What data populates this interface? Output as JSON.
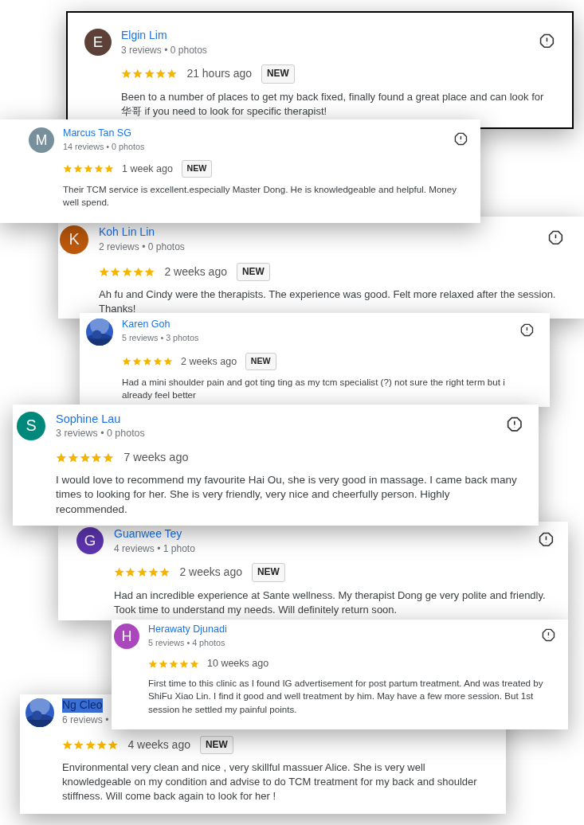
{
  "reviews": [
    {
      "name": "Elgin Lim",
      "name_highlighted": false,
      "meta": "3 reviews • 0 photos",
      "avatar": {
        "kind": "letter",
        "letter": "E",
        "color": "#5d4037"
      },
      "stars": 5,
      "time": "21 hours ago",
      "badge": "NEW",
      "text": "Been to a number of places to get my back fixed, finally found a great place and can look for 华哥 if you need to look for specific therapist!"
    },
    {
      "name": "Marcus Tan SG",
      "name_highlighted": false,
      "meta": "14 reviews • 0 photos",
      "avatar": {
        "kind": "letter",
        "letter": "M",
        "color": "#78909c"
      },
      "stars": 5,
      "time": "1 week ago",
      "badge": "NEW",
      "text": "Their TCM service is excellent.especially Master Dong. He is knowledgeable and helpful. Money well spend."
    },
    {
      "name": "Koh Lin Lin",
      "name_highlighted": false,
      "meta": "2 reviews • 0 photos",
      "avatar": {
        "kind": "letter",
        "letter": "K",
        "color": "#bf5a0b"
      },
      "stars": 5,
      "time": "2 weeks ago",
      "badge": "NEW",
      "text": "Ah fu and Cindy were the therapists. The experience was good. Felt more relaxed after the session. Thanks!"
    },
    {
      "name": "Karen Goh",
      "name_highlighted": false,
      "meta": "5 reviews • 3 photos",
      "stars": 5,
      "time": "2 weeks ago",
      "badge": "NEW",
      "text": "Had a mini shoulder pain and got ting ting as my tcm specialist (?) not sure the right term but i already feel better"
    },
    {
      "name": "Sophine Lau",
      "name_highlighted": false,
      "meta": "3 reviews • 0 photos",
      "avatar": {
        "kind": "letter",
        "letter": "S",
        "color": "#00897b"
      },
      "stars": 5,
      "time": "7 weeks ago",
      "text": "I would love to recommend my favourite Hai Ou, she is very good in massage. I came back many times to looking for her. She is very friendly, very nice and cheerfully person. Highly recommended."
    },
    {
      "name": "Guanwee Tey",
      "name_highlighted": false,
      "meta": "4 reviews • 1 photo",
      "avatar": {
        "kind": "letter",
        "letter": "G",
        "color": "#5e35b1"
      },
      "stars": 5,
      "time": "2 weeks ago",
      "badge": "NEW",
      "text": "Had an incredible experience at Sante wellness. My therapist Dong ge very polite and friendly. Took time to understand my needs. Will definitely return soon."
    },
    {
      "name": "Herawaty Djunadi",
      "name_highlighted": false,
      "meta": "5 reviews • 4 photos",
      "avatar": {
        "kind": "letter",
        "letter": "H",
        "color": "#ab47bc"
      },
      "stars": 5,
      "time": "10 weeks ago",
      "text": "First time to this clinic as I found IG advertisement for post partum treatment. And was treated by ShiFu Xiao Lin. I find it good and well treatment by him. May have a few more session. But 1st session he settled my painful points."
    },
    {
      "name": "Ng Cleo",
      "name_highlighted": true,
      "meta": "6 reviews •",
      "stars": 5,
      "time": "4 weeks ago",
      "badge": "NEW",
      "text": "Environmental very clean and nice , very skillful massuer Alice. She is very well knowledgeable on my condition and advise to do TCM treatment for my back and shoulder stiffness. Will come back again to look for her !"
    }
  ]
}
